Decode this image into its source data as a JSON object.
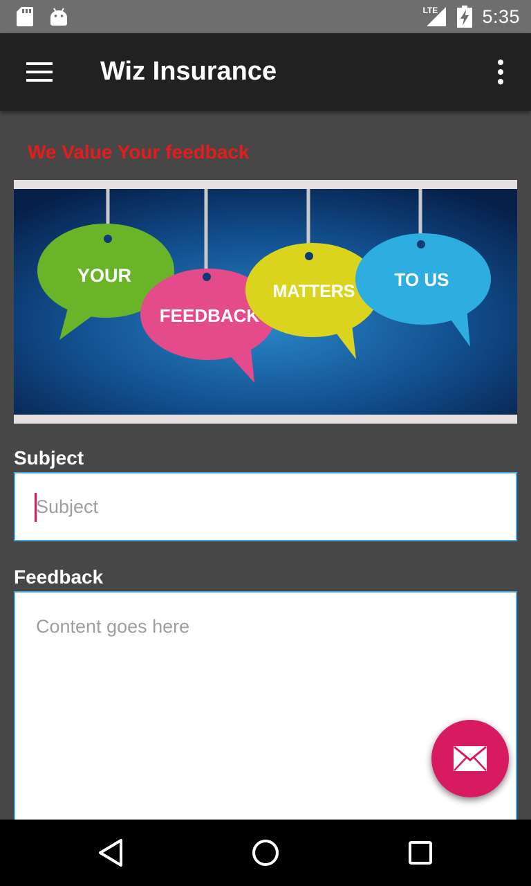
{
  "status_bar": {
    "network": "LTE",
    "time": "5:35"
  },
  "app_bar": {
    "title": "Wiz Insurance"
  },
  "page": {
    "headline": "We Value Your feedback",
    "banner_words": [
      "YOUR",
      "FEEDBACK",
      "MATTERS",
      "TO US"
    ],
    "subject": {
      "label": "Subject",
      "placeholder": "Subject",
      "value": ""
    },
    "feedback": {
      "label": "Feedback",
      "placeholder": "Content goes here",
      "value": ""
    }
  },
  "colors": {
    "status_bar": "#6e6e6e",
    "app_bar": "#212121",
    "background": "#474747",
    "headline": "#e51c1c",
    "accent": "#d81b60",
    "input_border": "#4aa3df"
  },
  "icons": {
    "menu": "hamburger-icon",
    "overflow": "more-vert-icon",
    "fab": "mail-icon",
    "nav": [
      "back-icon",
      "home-icon",
      "recents-icon"
    ]
  }
}
